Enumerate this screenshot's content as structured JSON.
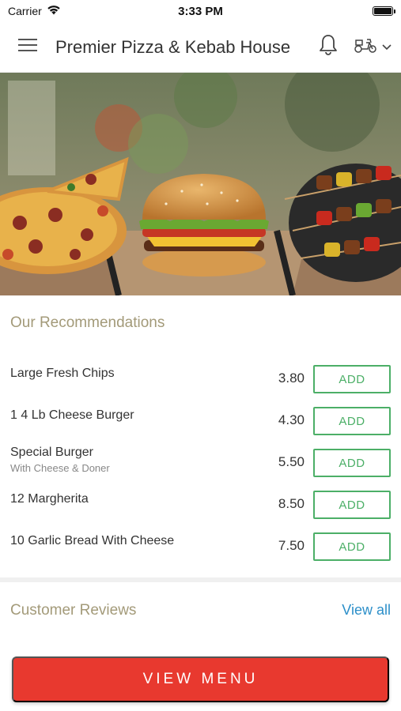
{
  "status_bar": {
    "carrier": "Carrier",
    "time": "3:33 PM"
  },
  "header": {
    "title": "Premier Pizza & Kebab House"
  },
  "recommendations": {
    "title": "Our Recommendations",
    "add_label": "ADD",
    "items": [
      {
        "name": "Large Fresh Chips",
        "subtitle": "",
        "price": "3.80"
      },
      {
        "name": "1 4 Lb Cheese Burger",
        "subtitle": "",
        "price": "4.30"
      },
      {
        "name": "Special Burger",
        "subtitle": "With Cheese & Doner",
        "price": "5.50"
      },
      {
        "name": "12 Margherita",
        "subtitle": "",
        "price": "8.50"
      },
      {
        "name": "10 Garlic Bread With Cheese",
        "subtitle": "",
        "price": "7.50"
      }
    ]
  },
  "reviews": {
    "title": "Customer Reviews",
    "view_all": "View all"
  },
  "footer": {
    "view_menu": "VIEW MENU"
  },
  "colors": {
    "accent_green": "#4caf67",
    "cta_red": "#e8392f",
    "link_blue": "#2c8fc9",
    "section_title": "#a39a79"
  },
  "icons": {
    "menu": "hamburger-menu-icon",
    "bell": "bell-icon",
    "delivery": "scooter-icon",
    "dropdown": "chevron-down-icon",
    "wifi": "wifi-icon",
    "battery": "battery-icon"
  }
}
